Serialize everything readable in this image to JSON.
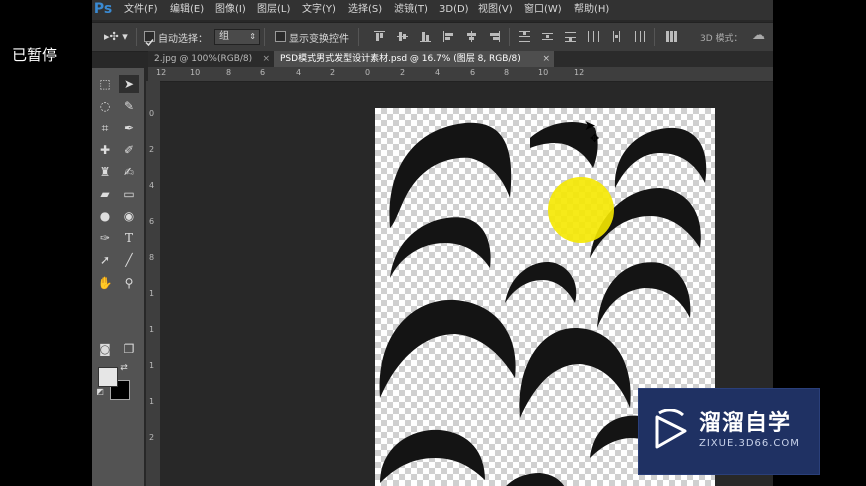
{
  "status_overlay": "已暂停",
  "app": {
    "logo": "Ps",
    "menu": [
      "文件(F)",
      "编辑(E)",
      "图像(I)",
      "图层(L)",
      "文字(Y)",
      "选择(S)",
      "滤镜(T)",
      "3D(D)",
      "视图(V)",
      "窗口(W)",
      "帮助(H)"
    ]
  },
  "options": {
    "auto_select_label": "自动选择：",
    "auto_select_checked": true,
    "auto_select_value": "组",
    "show_transform_label": "显示变换控件",
    "show_transform_checked": false,
    "mode_label": "3D 模式："
  },
  "tabs": [
    {
      "label": "2.jpg @ 100%(RGB/8)",
      "active": false
    },
    {
      "label": "PSD模式男式发型设计素材.psd @ 16.7% (图层 8, RGB/8)",
      "active": true
    }
  ],
  "tools": [
    "marquee-icon",
    "move-icon",
    "lasso-icon",
    "quick-select-icon",
    "crop-icon",
    "eyedropper-icon",
    "healing-brush-icon",
    "brush-icon",
    "clone-stamp-icon",
    "history-brush-icon",
    "eraser-icon",
    "gradient-icon",
    "blur-icon",
    "dodge-icon",
    "pen-icon",
    "type-icon",
    "path-select-icon",
    "line-icon",
    "hand-icon",
    "zoom-icon"
  ],
  "ruler": {
    "top_ticks": [
      "12",
      "10",
      "8",
      "6",
      "4",
      "2",
      "0",
      "2",
      "4",
      "6",
      "8",
      "10",
      "12"
    ],
    "left_ticks": [
      "0",
      "2",
      "4",
      "6",
      "8",
      "1",
      "1",
      "1",
      "1",
      "2"
    ]
  },
  "watermark": {
    "title": "溜溜自学",
    "subtitle": "ZIXUE.3D66.COM"
  },
  "colors": {
    "photoshop_blue": "#3a8ad2",
    "cursor_highlight": "#f5e800",
    "watermark_bg": "#1f3163"
  }
}
